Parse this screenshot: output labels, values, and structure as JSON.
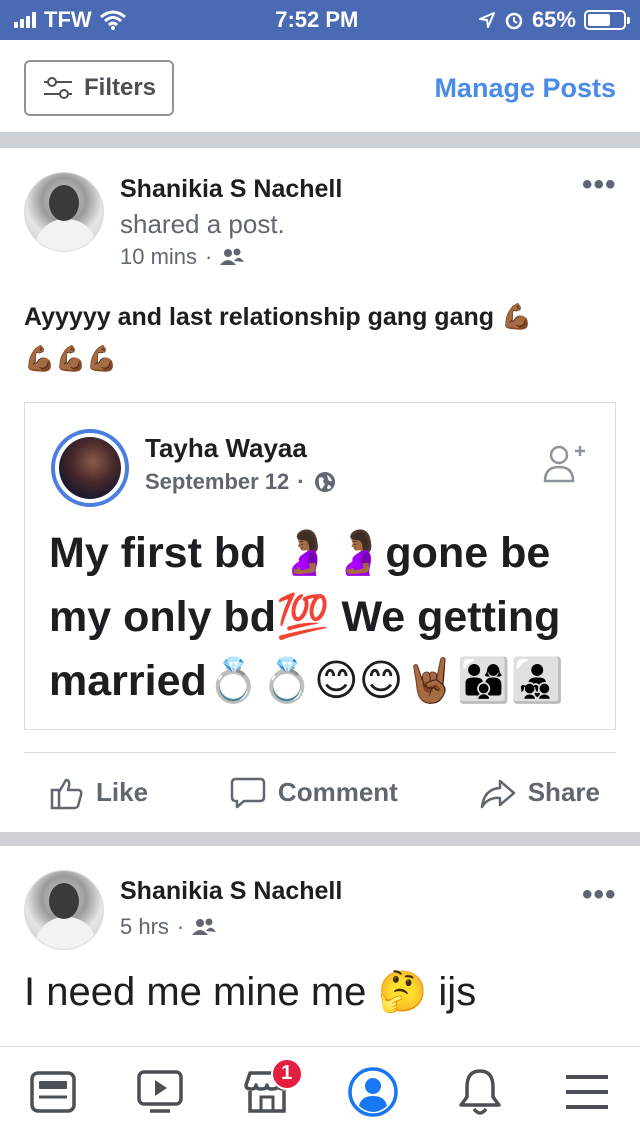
{
  "status_bar": {
    "carrier": "TFW",
    "time": "7:52 PM",
    "battery_percent": "65%",
    "battery_level": 0.65,
    "icons": [
      "signal-icon",
      "wifi-icon",
      "location-icon",
      "alarm-icon",
      "battery-icon"
    ]
  },
  "toolbar": {
    "filters_label": "Filters",
    "manage_posts_label": "Manage Posts"
  },
  "posts": [
    {
      "author": "Shanikia S Nachell",
      "action": "shared a post.",
      "time": "10 mins",
      "audience_icon": "friends-icon",
      "text_line1": "Ayyyyy and last relationship gang gang 💪🏾",
      "text_line2": "💪🏾💪🏾💪🏾",
      "shared": {
        "author": "Tayha Wayaa",
        "date": "September 12",
        "audience_icon": "globe-icon",
        "text": "My first bd 🤰🏾🤰🏾gone be my only bd💯 We getting married💍💍😊😊🤘🏾👨‍👩‍👦👨‍👧‍👦"
      },
      "actions": {
        "like": "Like",
        "comment": "Comment",
        "share": "Share"
      }
    },
    {
      "author": "Shanikia S Nachell",
      "time": "5 hrs",
      "audience_icon": "friends-icon",
      "text": "I need me mine me 🤔 ijs"
    }
  ],
  "bottom_nav": {
    "items": [
      "news-feed-icon",
      "watch-icon",
      "marketplace-icon",
      "profile-icon",
      "notifications-icon",
      "menu-icon"
    ],
    "marketplace_badge": "1"
  },
  "colors": {
    "status_bar": "#4a6bb4",
    "link_blue": "#4a8ae8",
    "badge_red": "#e41e3f"
  }
}
